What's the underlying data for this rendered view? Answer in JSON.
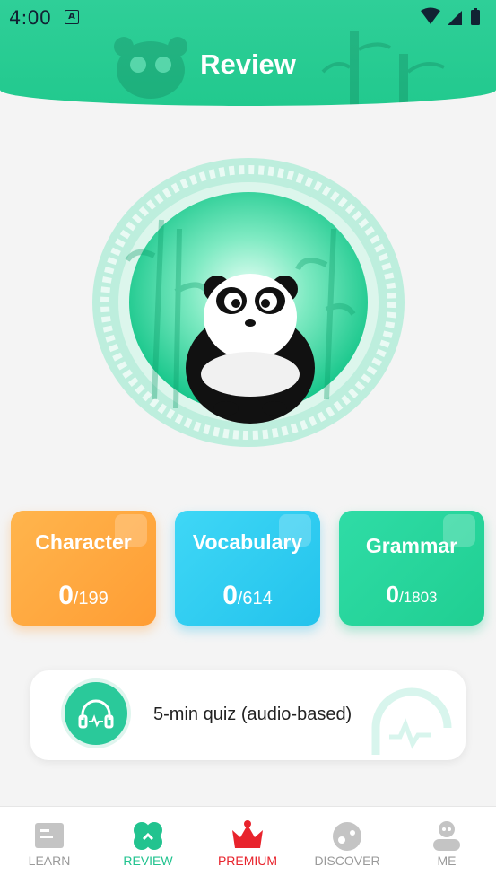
{
  "status_bar": {
    "time": "4:00",
    "notification_icon": "A"
  },
  "header": {
    "title": "Review"
  },
  "cards": [
    {
      "title": "Character",
      "count": "0",
      "total": "/199",
      "color": "#ffa640",
      "icon": "star-badge-icon"
    },
    {
      "title": "Vocabulary",
      "count": "0",
      "total": "/614",
      "color": "#2fcff0",
      "icon": "book-icon"
    },
    {
      "title": "Grammar",
      "count": "0",
      "total": "/1803",
      "color": "#26d69c",
      "icon": "notebook-icon"
    }
  ],
  "quiz": {
    "label": "5-min quiz (audio-based)",
    "icon": "headphones-icon"
  },
  "nav": [
    {
      "label": "LEARN",
      "icon": "book-open-icon",
      "color": "#9a9a9a"
    },
    {
      "label": "REVIEW",
      "icon": "clover-icon",
      "color": "#22c38f"
    },
    {
      "label": "PREMIUM",
      "icon": "crown-icon",
      "color": "#e8232c"
    },
    {
      "label": "DISCOVER",
      "icon": "planet-icon",
      "color": "#9a9a9a"
    },
    {
      "label": "ME",
      "icon": "user-icon",
      "color": "#9a9a9a"
    }
  ]
}
